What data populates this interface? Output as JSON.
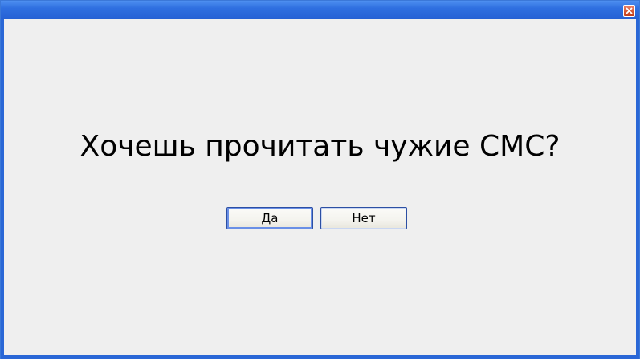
{
  "window": {
    "title": ""
  },
  "dialog": {
    "question": "Хочешь прочитать чужие СМС?",
    "yes_label": "Да",
    "no_label": "Нет"
  },
  "icons": {
    "close": "close-icon"
  },
  "colors": {
    "titlebar": "#2f6fe0",
    "client_background": "#efefef",
    "close_button": "#d4552f",
    "button_border": "#2c4fa3"
  }
}
